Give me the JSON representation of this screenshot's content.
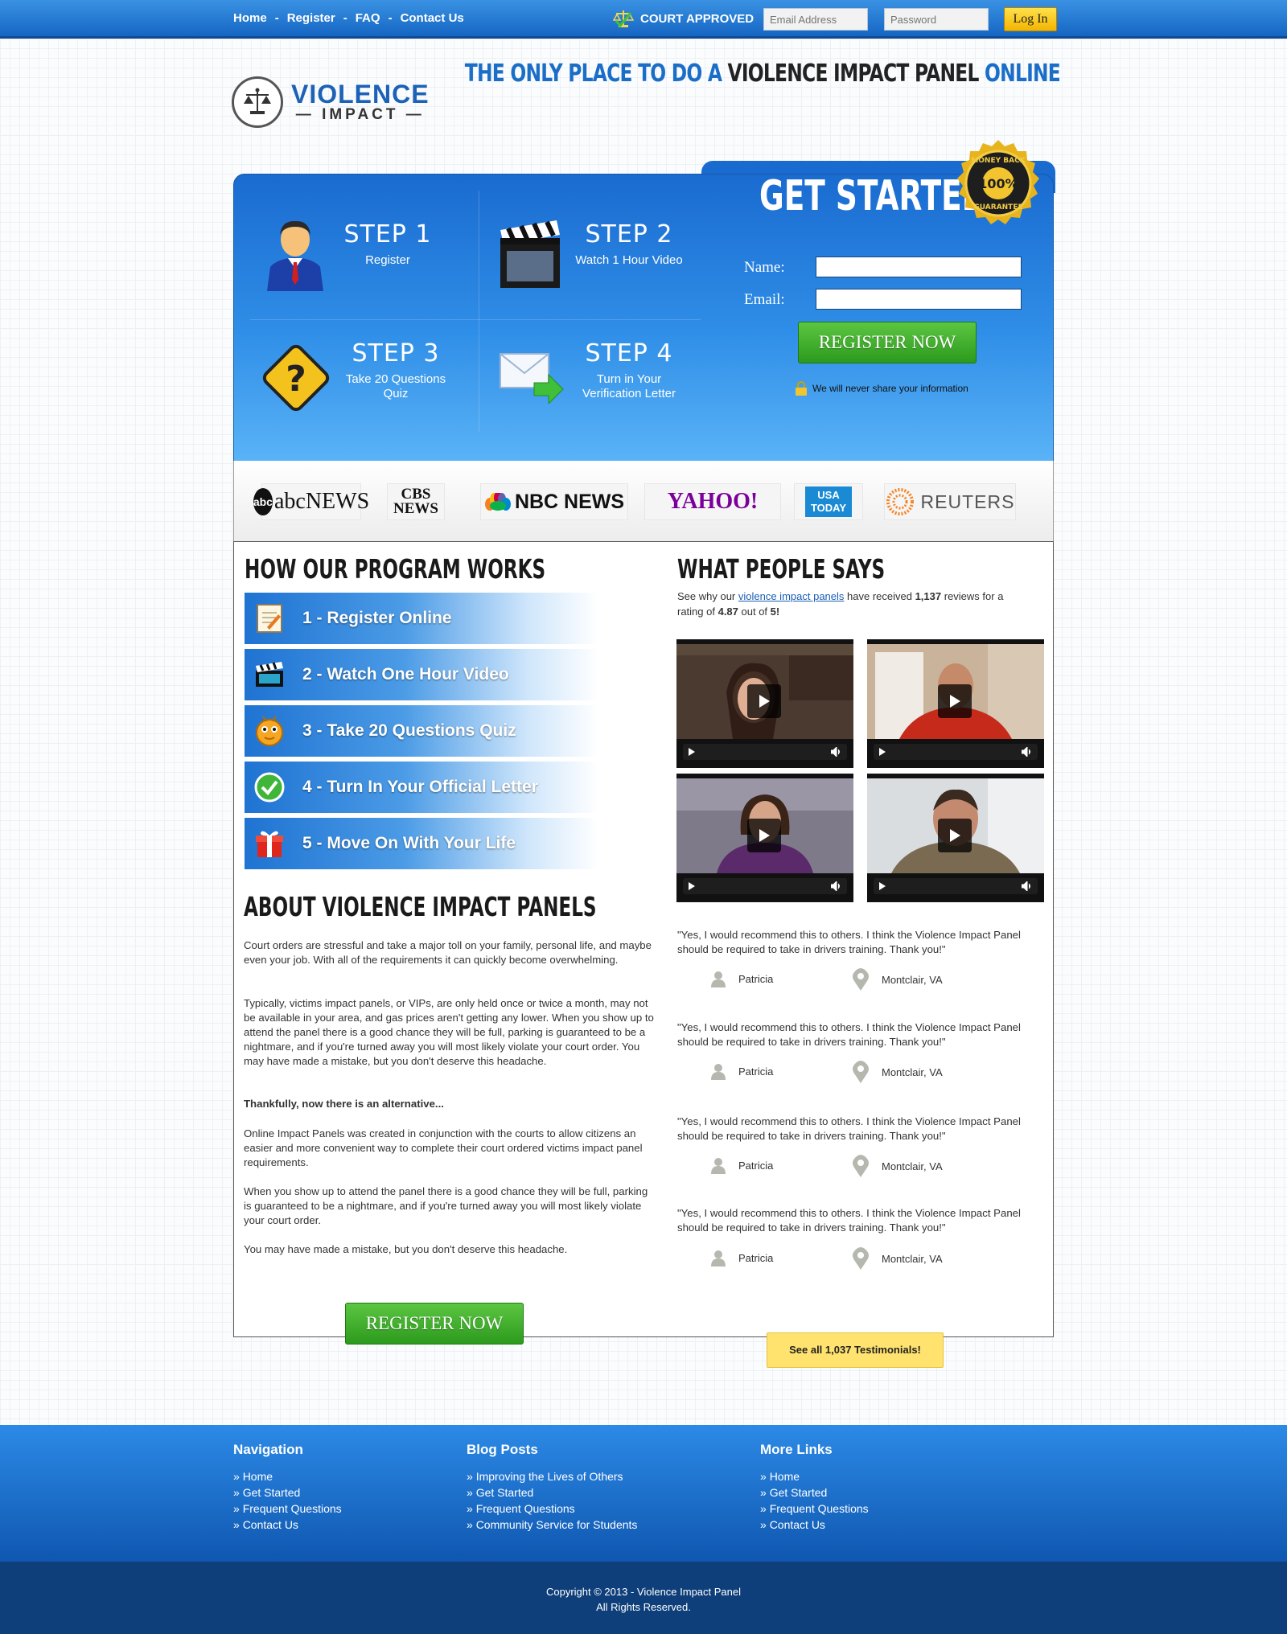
{
  "topbar": {
    "nav": [
      "Home",
      "Register",
      "FAQ",
      "Contact Us"
    ],
    "nav_sep": "-",
    "court_approved": "COURT APPROVED",
    "email_placeholder": "Email Address",
    "password_placeholder": "Password",
    "login_label": "Log In"
  },
  "header": {
    "logo_line1": "VIOLENCE",
    "logo_line2": "IMPACT",
    "tagline_part1": "THE ONLY PLACE TO DO A",
    "tagline_part2": "VIOLENCE IMPACT PANEL",
    "tagline_part3": "ONLINE"
  },
  "hero": {
    "steps": [
      {
        "title": "STEP  1",
        "desc": "Register",
        "icon": "businessman-icon"
      },
      {
        "title": "STEP  2",
        "desc": "Watch 1 Hour Video",
        "icon": "clapperboard-icon"
      },
      {
        "title": "STEP  3",
        "desc": "Take 20 Questions Quiz",
        "icon": "question-icon"
      },
      {
        "title": "STEP  4",
        "desc": "Turn in Your Verification Letter",
        "icon": "envelope-arrow-icon"
      }
    ],
    "get_started": "GET STARTED",
    "badge_top": "MONEY BACK",
    "badge_mid": "100%",
    "badge_bottom": "GUARANTEE",
    "name_label": "Name:",
    "email_label": "Email:",
    "register_label": "REGISTER NOW",
    "privacy": "We will never share your information"
  },
  "media_logos": [
    "abcNEWS",
    "CBS NEWS",
    "NBC NEWS",
    "YAHOO!",
    "USA TODAY",
    "REUTERS"
  ],
  "program": {
    "title": "HOW OUR PROGRAM WORKS",
    "items": [
      {
        "label": "1 - Register Online",
        "icon": "notepad-icon"
      },
      {
        "label": "2 - Watch One Hour Video",
        "icon": "clapperboard-icon"
      },
      {
        "label": "3 - Take 20 Questions Quiz",
        "icon": "question-bubble-icon"
      },
      {
        "label": "4 - Turn In Your Official Letter",
        "icon": "checkmark-icon"
      },
      {
        "label": "5 - Move On With Your Life",
        "icon": "gift-icon"
      }
    ]
  },
  "about": {
    "title": "ABOUT VIOLENCE IMPACT PANELS",
    "p1": "Court orders are stressful and take a major toll on your family, personal life, and maybe even your job. With all of the requirements it can quickly become overwhelming.",
    "p2": "Typically, victims impact panels, or VIPs, are only held once or twice a month, may not be available in your area, and gas prices aren't getting any lower. When you show up to attend the panel there is a good chance they will be full, parking is guaranteed to be a nightmare, and if you're turned away you will most likely violate your court order. You may have made a mistake, but you don't deserve this headache.",
    "p3": "Thankfully, now there is an alternative...",
    "p4": "Online Impact Panels was created in conjunction with the courts to allow citizens an easier and more convenient way to complete their court ordered victims impact panel requirements.",
    "p5": "When you show up to attend the panel there is a good chance they will be full, parking is guaranteed to be a nightmare, and if you're turned away you will most likely violate your court order.",
    "p6": "You may have made a mistake, but you don't deserve this headache.",
    "register_label": "REGISTER NOW"
  },
  "testimonials": {
    "title": "WHAT PEOPLE SAYS",
    "intro_a": "See why our ",
    "intro_link": "violence impact panels",
    "intro_b": " have received ",
    "count": "1,137",
    "intro_c": " reviews for a rating of ",
    "rating": "4.87",
    "intro_d": " out of ",
    "max": "5!",
    "quotes": [
      {
        "text": "\"Yes, I would recommend this to others. I think the Violence Impact Panel should be required to take in drivers training. Thank you!\"",
        "name": "Patricia",
        "location": "Montclair, VA"
      },
      {
        "text": "\"Yes, I would recommend this to others. I think the Violence Impact Panel should be required to take in drivers training. Thank you!\"",
        "name": "Patricia",
        "location": "Montclair, VA"
      },
      {
        "text": "\"Yes, I would recommend this to others. I think the Violence Impact Panel should be required to take in drivers training. Thank you!\"",
        "name": "Patricia",
        "location": "Montclair, VA"
      },
      {
        "text": "\"Yes, I would recommend this to others. I think the Violence Impact Panel should be required to take in drivers training. Thank you!\"",
        "name": "Patricia",
        "location": "Montclair, VA"
      }
    ],
    "see_all": "See all 1,037 Testimonials!"
  },
  "footer": {
    "navigation": {
      "title": "Navigation",
      "links": [
        "Home",
        "Get Started",
        "Frequent Questions",
        "Contact Us"
      ]
    },
    "blog": {
      "title": "Blog Posts",
      "links": [
        "Improving the Lives of Others",
        "Get Started",
        "Frequent Questions",
        "Community Service for Students"
      ]
    },
    "more": {
      "title": "More Links",
      "links": [
        "Home",
        "Get Started",
        "Frequent Questions",
        "Contact Us"
      ]
    },
    "copyright": "Copyright © 2013 - Violence Impact Panel",
    "rights": "All Rights Reserved."
  },
  "colors": {
    "brand_blue": "#1a6bd0",
    "cta_green": "#2c9a1d",
    "login_yellow": "#f3b400",
    "testimonial_yellow": "#ffe36e"
  }
}
